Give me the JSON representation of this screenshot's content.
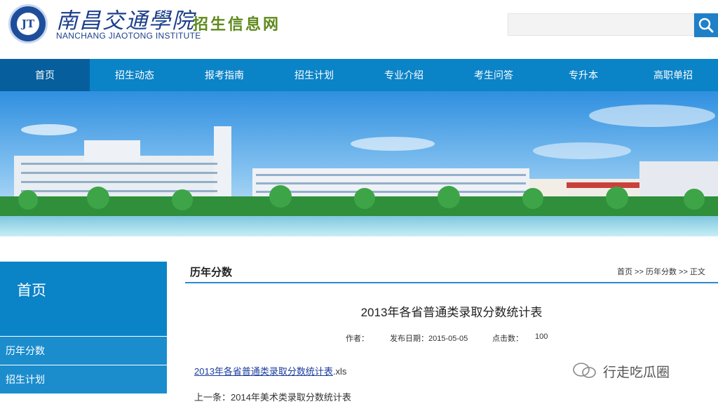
{
  "header": {
    "logo_text": "JT",
    "school_name_cn": "南昌交通學院",
    "school_name_en": "NANCHANG JIAOTONG INSTITUTE",
    "site_name": "招生信息网",
    "search_placeholder": ""
  },
  "nav": {
    "items": [
      "首页",
      "招生动态",
      "报考指南",
      "招生计划",
      "专业介绍",
      "考生问答",
      "专升本",
      "高职单招"
    ],
    "active_index": 0
  },
  "sidebar": {
    "title": "首页",
    "items": [
      "历年分数",
      "招生计划"
    ]
  },
  "content": {
    "section_title": "历年分数",
    "breadcrumb": "首页 >> 历年分数 >> 正文",
    "article_title": "2013年各省普通类录取分数统计表",
    "author_label": "作者：",
    "date_label": "发布日期：2015-05-05",
    "clicks_label": "点击数：",
    "clicks_value": "100",
    "attachment_link": "2013年各省普通类录取分数统计表",
    "attachment_ext": ".xls",
    "prev_item": "上一条：2014年美术类录取分数统计表"
  },
  "watermark": {
    "text": "行走吃瓜圈"
  },
  "colors": {
    "nav_bg": "#0b83c7",
    "nav_active": "#065f9c",
    "accent_green": "#5e8a1c",
    "brand_blue": "#1c3f8b"
  }
}
